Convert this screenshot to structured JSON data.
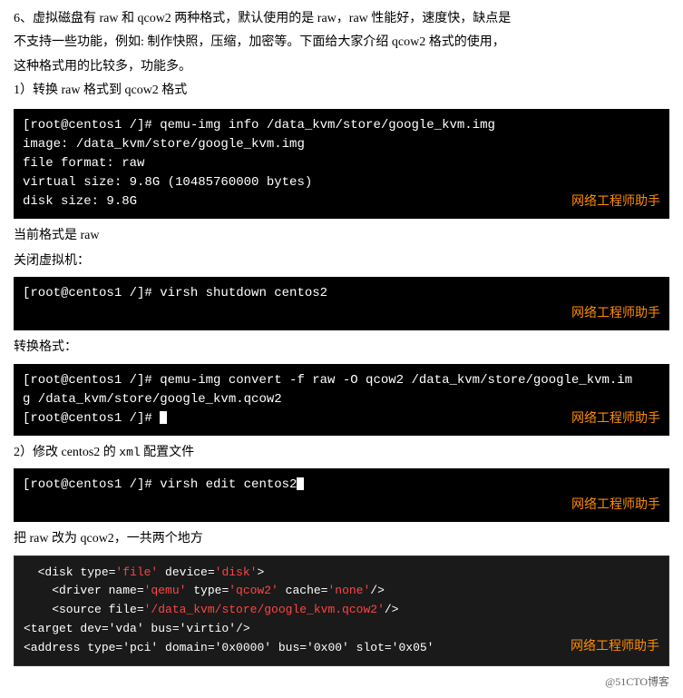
{
  "intro": {
    "line1": "6、虚拟磁盘有 raw 和 qcow2 两种格式，默认使用的是 raw，raw 性能好，速度快，缺点是",
    "line2": "不支持一些功能，例如: 制作快照，压缩，加密等。下面给大家介绍 qcow2 格式的使用，",
    "line3": "这种格式用的比较多，功能多。",
    "line4": "1）转换 raw 格式到 qcow2 格式"
  },
  "terminal1": {
    "line1": "[root@centos1 /]# qemu-img info /data_kvm/store/google_kvm.img",
    "line2": "image: /data_kvm/store/google_kvm.img",
    "line3": "file format: raw",
    "line4": "virtual size: 9.8G (10485760000 bytes)",
    "line5": "disk size: 9.8G",
    "watermark": "网络工程师助手"
  },
  "label1": "当前格式是 raw",
  "label2": "关闭虚拟机：",
  "terminal2": {
    "line1": "[root@centos1 /]# virsh shutdown centos2",
    "watermark": "网络工程师助手"
  },
  "label3": "转换格式：",
  "terminal3": {
    "line1": "[root@centos1 /]# qemu-img convert -f raw -O qcow2 /data_kvm/store/google_kvm.im",
    "line2": "g /data_kvm/store/google_kvm.qcow2",
    "line3": "[root@centos1 /]# ",
    "watermark": "网络工程师助手"
  },
  "label4": "2）修改 centos2 的 xml 配置文件",
  "terminal4": {
    "line1": "[root@centos1 /]# virsh edit centos2",
    "watermark": "网络工程师助手"
  },
  "label5": "把 raw 改为 qcow2，一共两个地方",
  "terminal5": {
    "line1": "  <disk type='file' device='disk'>",
    "line2_pre": "    <driver name='qemu' type=",
    "line2_red": "'qcow2'",
    "line2_mid": " cache=",
    "line2_red2": "'none'",
    "line2_end": "/>",
    "line3_pre": "    <source file=",
    "line3_red": "'/data_kvm/store/google_kvm.qcow2'",
    "line3_end": "/>",
    "line4": "    <target dev='vda' bus='virtio'/>",
    "line5": "    <address type='pci' domain='0x0000'  bus='0x00'  slot='0x05'",
    "watermark": "网络工程师助手"
  },
  "bottom_credit": "@51CTO博客"
}
